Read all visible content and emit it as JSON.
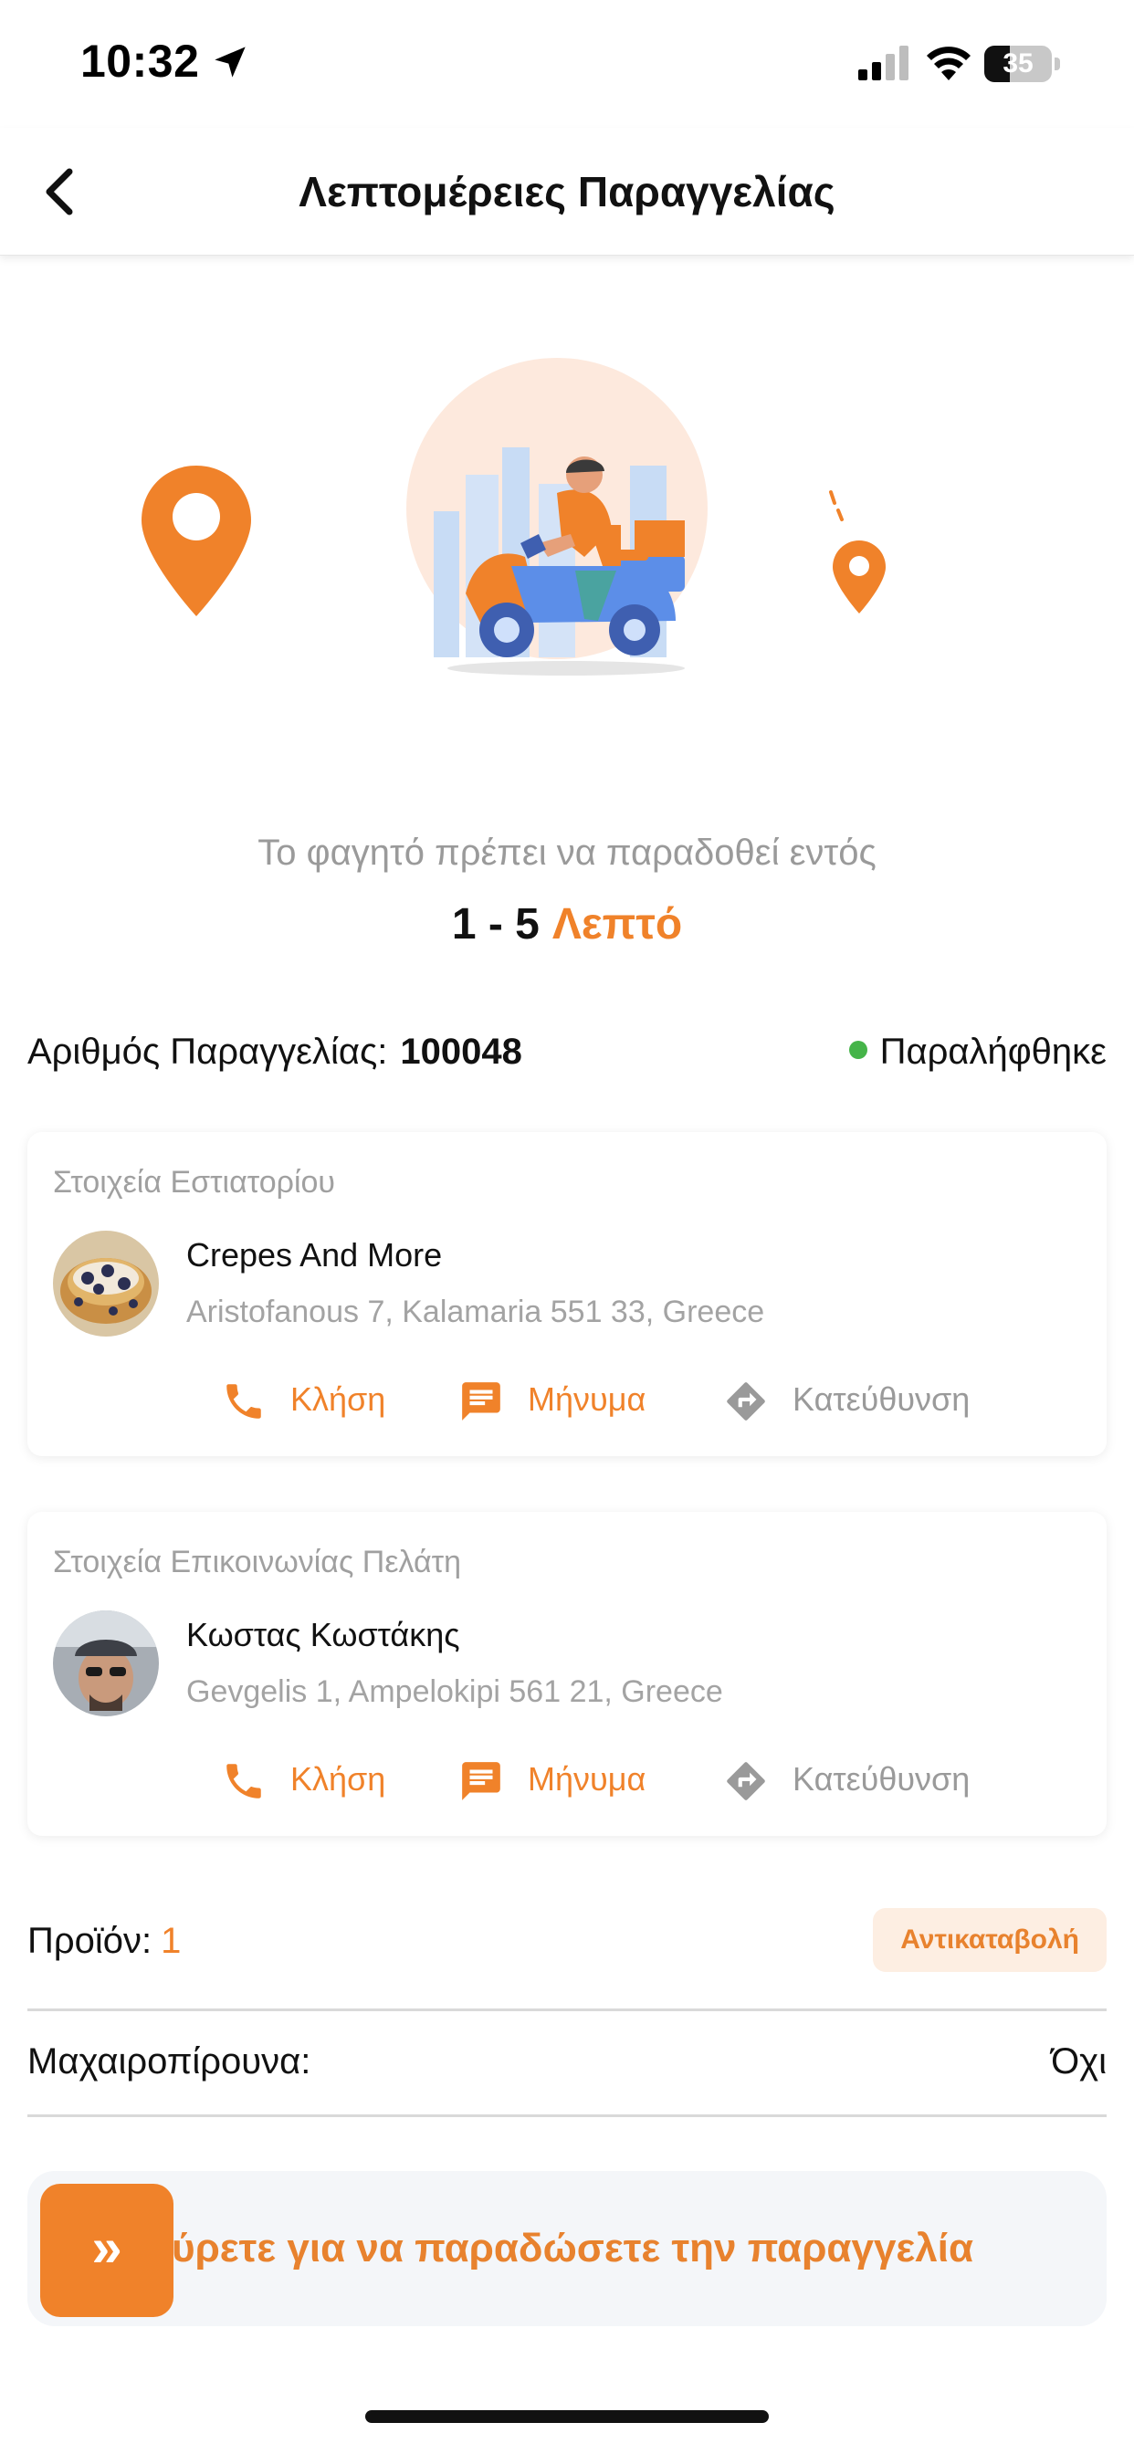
{
  "status_bar": {
    "time": "10:32",
    "battery": "35"
  },
  "nav": {
    "title": "Λεπτομέρειες Παραγγελίας"
  },
  "delivery": {
    "text": "Το φαγητό πρέπει να παραδοθεί εντός",
    "range": "1 - 5",
    "unit": "Λεπτό"
  },
  "order": {
    "label": "Αριθμός Παραγγελίας:",
    "number": "100048",
    "status": "Παραλήφθηκε",
    "status_color": "#45b449"
  },
  "restaurant": {
    "section_title": "Στοιχεία Εστιατορίου",
    "name": "Crepes And More",
    "address": "Aristofanous 7, Kalamaria 551 33, Greece",
    "call_label": "Κλήση",
    "message_label": "Μήνυμα",
    "direction_label": "Κατεύθυνση"
  },
  "customer": {
    "section_title": "Στοιχεία Επικοινωνίας Πελάτη",
    "name": "Κωστας Κωστάκης",
    "address": "Gevgelis 1, Ampelokipi 561 21, Greece",
    "call_label": "Κλήση",
    "message_label": "Μήνυμα",
    "direction_label": "Κατεύθυνση"
  },
  "product": {
    "label": "Προϊόν:",
    "count": "1",
    "replace_label": "Αντικαταβολή"
  },
  "cutlery": {
    "label": "Μαχαιροπίρουνα:",
    "value": "Όχι"
  },
  "swipe": {
    "text": "ύρετε για να παραδώσετε την παραγγελία",
    "handle_icon": "»"
  },
  "colors": {
    "accent": "#f0822a",
    "muted": "#9a9a9a",
    "success": "#45b449"
  },
  "icons": [
    "location-arrow-icon",
    "signal-icon",
    "wifi-icon",
    "battery-icon",
    "back-chevron-icon",
    "map-pin-icon",
    "delivery-scooter-illustration",
    "phone-icon",
    "message-icon",
    "direction-icon",
    "double-chevron-icon"
  ]
}
